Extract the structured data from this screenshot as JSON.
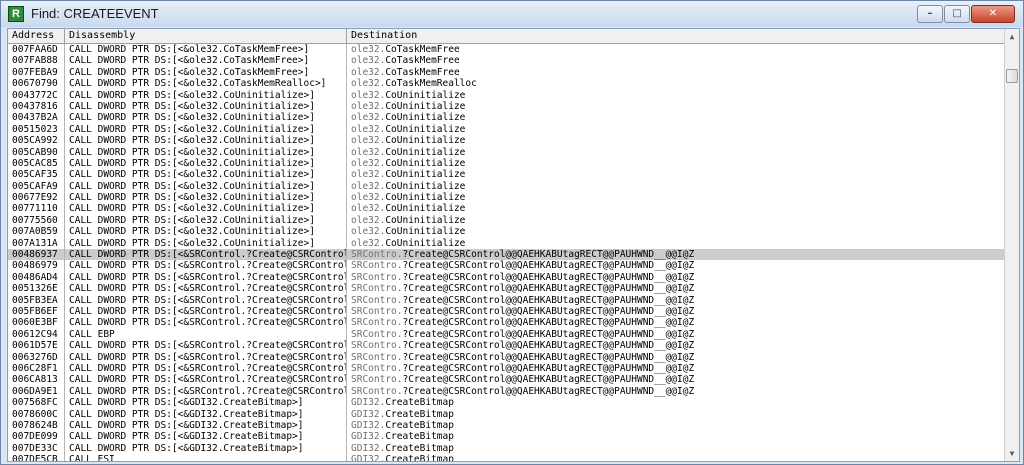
{
  "window": {
    "title": "Find: CREATEEVENT",
    "app_icon": "R"
  },
  "controls": {
    "minimize": "–",
    "maximize": "□",
    "close": "✕"
  },
  "columns": {
    "address": "Address",
    "disassembly": "Disassembly",
    "destination": "Destination"
  },
  "scroll": {
    "up": "▲",
    "down": "▼"
  },
  "selected_row": 18,
  "rows": [
    {
      "address": "007FAA6D",
      "disassembly": "CALL DWORD PTR DS:[<&ole32.CoTaskMemFree>]",
      "dst_module": "ole32.",
      "dst_func": "CoTaskMemFree"
    },
    {
      "address": "007FAB88",
      "disassembly": "CALL DWORD PTR DS:[<&ole32.CoTaskMemFree>]",
      "dst_module": "ole32.",
      "dst_func": "CoTaskMemFree"
    },
    {
      "address": "007FEBA9",
      "disassembly": "CALL DWORD PTR DS:[<&ole32.CoTaskMemFree>]",
      "dst_module": "ole32.",
      "dst_func": "CoTaskMemFree"
    },
    {
      "address": "00670790",
      "disassembly": "CALL DWORD PTR DS:[<&ole32.CoTaskMemRealloc>]",
      "dst_module": "ole32.",
      "dst_func": "CoTaskMemRealloc"
    },
    {
      "address": "0043772C",
      "disassembly": "CALL DWORD PTR DS:[<&ole32.CoUninitialize>]",
      "dst_module": "ole32.",
      "dst_func": "CoUninitialize"
    },
    {
      "address": "00437816",
      "disassembly": "CALL DWORD PTR DS:[<&ole32.CoUninitialize>]",
      "dst_module": "ole32.",
      "dst_func": "CoUninitialize"
    },
    {
      "address": "00437B2A",
      "disassembly": "CALL DWORD PTR DS:[<&ole32.CoUninitialize>]",
      "dst_module": "ole32.",
      "dst_func": "CoUninitialize"
    },
    {
      "address": "00515023",
      "disassembly": "CALL DWORD PTR DS:[<&ole32.CoUninitialize>]",
      "dst_module": "ole32.",
      "dst_func": "CoUninitialize"
    },
    {
      "address": "005CA992",
      "disassembly": "CALL DWORD PTR DS:[<&ole32.CoUninitialize>]",
      "dst_module": "ole32.",
      "dst_func": "CoUninitialize"
    },
    {
      "address": "005CAB90",
      "disassembly": "CALL DWORD PTR DS:[<&ole32.CoUninitialize>]",
      "dst_module": "ole32.",
      "dst_func": "CoUninitialize"
    },
    {
      "address": "005CAC85",
      "disassembly": "CALL DWORD PTR DS:[<&ole32.CoUninitialize>]",
      "dst_module": "ole32.",
      "dst_func": "CoUninitialize"
    },
    {
      "address": "005CAF35",
      "disassembly": "CALL DWORD PTR DS:[<&ole32.CoUninitialize>]",
      "dst_module": "ole32.",
      "dst_func": "CoUninitialize"
    },
    {
      "address": "005CAFA9",
      "disassembly": "CALL DWORD PTR DS:[<&ole32.CoUninitialize>]",
      "dst_module": "ole32.",
      "dst_func": "CoUninitialize"
    },
    {
      "address": "00677E92",
      "disassembly": "CALL DWORD PTR DS:[<&ole32.CoUninitialize>]",
      "dst_module": "ole32.",
      "dst_func": "CoUninitialize"
    },
    {
      "address": "00771110",
      "disassembly": "CALL DWORD PTR DS:[<&ole32.CoUninitialize>]",
      "dst_module": "ole32.",
      "dst_func": "CoUninitialize"
    },
    {
      "address": "00775560",
      "disassembly": "CALL DWORD PTR DS:[<&ole32.CoUninitialize>]",
      "dst_module": "ole32.",
      "dst_func": "CoUninitialize"
    },
    {
      "address": "007A0B59",
      "disassembly": "CALL DWORD PTR DS:[<&ole32.CoUninitialize>]",
      "dst_module": "ole32.",
      "dst_func": "CoUninitialize"
    },
    {
      "address": "007A131A",
      "disassembly": "CALL DWORD PTR DS:[<&ole32.CoUninitialize>]",
      "dst_module": "ole32.",
      "dst_func": "CoUninitialize"
    },
    {
      "address": "00486937",
      "disassembly": "CALL DWORD PTR DS:[<&SRControl.?Create@CSRControl",
      "dst_module": "SRContro.",
      "dst_func": "?Create@CSRControl@@QAEHKABUtagRECT@@PAUHWND__@@I@Z"
    },
    {
      "address": "00486979",
      "disassembly": "CALL DWORD PTR DS:[<&SRControl.?Create@CSRControl",
      "dst_module": "SRContro.",
      "dst_func": "?Create@CSRControl@@QAEHKABUtagRECT@@PAUHWND__@@I@Z"
    },
    {
      "address": "00486AD4",
      "disassembly": "CALL DWORD PTR DS:[<&SRControl.?Create@CSRControl",
      "dst_module": "SRContro.",
      "dst_func": "?Create@CSRControl@@QAEHKABUtagRECT@@PAUHWND__@@I@Z"
    },
    {
      "address": "0051326E",
      "disassembly": "CALL DWORD PTR DS:[<&SRControl.?Create@CSRControl",
      "dst_module": "SRContro.",
      "dst_func": "?Create@CSRControl@@QAEHKABUtagRECT@@PAUHWND__@@I@Z"
    },
    {
      "address": "005FB3EA",
      "disassembly": "CALL DWORD PTR DS:[<&SRControl.?Create@CSRControl",
      "dst_module": "SRContro.",
      "dst_func": "?Create@CSRControl@@QAEHKABUtagRECT@@PAUHWND__@@I@Z"
    },
    {
      "address": "005FB6EF",
      "disassembly": "CALL DWORD PTR DS:[<&SRControl.?Create@CSRControl",
      "dst_module": "SRContro.",
      "dst_func": "?Create@CSRControl@@QAEHKABUtagRECT@@PAUHWND__@@I@Z"
    },
    {
      "address": "0060E3BF",
      "disassembly": "CALL DWORD PTR DS:[<&SRControl.?Create@CSRControl",
      "dst_module": "SRContro.",
      "dst_func": "?Create@CSRControl@@QAEHKABUtagRECT@@PAUHWND__@@I@Z"
    },
    {
      "address": "00612C94",
      "disassembly": "CALL EBP",
      "dst_module": "SRContro.",
      "dst_func": "?Create@CSRControl@@QAEHKABUtagRECT@@PAUHWND__@@I@Z"
    },
    {
      "address": "0061D57E",
      "disassembly": "CALL DWORD PTR DS:[<&SRControl.?Create@CSRControl",
      "dst_module": "SRContro.",
      "dst_func": "?Create@CSRControl@@QAEHKABUtagRECT@@PAUHWND__@@I@Z"
    },
    {
      "address": "0063276D",
      "disassembly": "CALL DWORD PTR DS:[<&SRControl.?Create@CSRControl",
      "dst_module": "SRContro.",
      "dst_func": "?Create@CSRControl@@QAEHKABUtagRECT@@PAUHWND__@@I@Z"
    },
    {
      "address": "006C28F1",
      "disassembly": "CALL DWORD PTR DS:[<&SRControl.?Create@CSRControl",
      "dst_module": "SRContro.",
      "dst_func": "?Create@CSRControl@@QAEHKABUtagRECT@@PAUHWND__@@I@Z"
    },
    {
      "address": "006CA813",
      "disassembly": "CALL DWORD PTR DS:[<&SRControl.?Create@CSRControl",
      "dst_module": "SRContro.",
      "dst_func": "?Create@CSRControl@@QAEHKABUtagRECT@@PAUHWND__@@I@Z"
    },
    {
      "address": "006DA9E1",
      "disassembly": "CALL DWORD PTR DS:[<&SRControl.?Create@CSRControl",
      "dst_module": "SRContro.",
      "dst_func": "?Create@CSRControl@@QAEHKABUtagRECT@@PAUHWND__@@I@Z"
    },
    {
      "address": "007568FC",
      "disassembly": "CALL DWORD PTR DS:[<&GDI32.CreateBitmap>]",
      "dst_module": "GDI32.",
      "dst_func": "CreateBitmap"
    },
    {
      "address": "0078600C",
      "disassembly": "CALL DWORD PTR DS:[<&GDI32.CreateBitmap>]",
      "dst_module": "GDI32.",
      "dst_func": "CreateBitmap"
    },
    {
      "address": "0078624B",
      "disassembly": "CALL DWORD PTR DS:[<&GDI32.CreateBitmap>]",
      "dst_module": "GDI32.",
      "dst_func": "CreateBitmap"
    },
    {
      "address": "007DE099",
      "disassembly": "CALL DWORD PTR DS:[<&GDI32.CreateBitmap>]",
      "dst_module": "GDI32.",
      "dst_func": "CreateBitmap"
    },
    {
      "address": "007DE33C",
      "disassembly": "CALL DWORD PTR DS:[<&GDI32.CreateBitmap>]",
      "dst_module": "GDI32.",
      "dst_func": "CreateBitmap"
    },
    {
      "address": "007DE5CB",
      "disassembly": "CALL ESI",
      "dst_module": "GDI32.",
      "dst_func": "CreateBitmap"
    }
  ]
}
